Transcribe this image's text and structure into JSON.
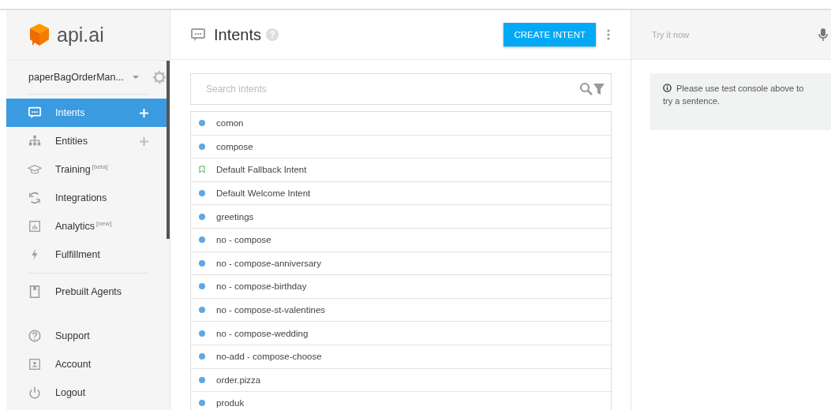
{
  "logo": {
    "text": "api.ai"
  },
  "agent": {
    "name": "paperBagOrderMan..."
  },
  "nav_groups": [
    {
      "items": [
        {
          "label": "Intents",
          "selected": true,
          "add": true
        },
        {
          "label": "Entities",
          "selected": false,
          "add": true
        },
        {
          "label": "Training",
          "selected": false,
          "add": false,
          "tag": "[beta]"
        },
        {
          "label": "Integrations",
          "selected": false,
          "add": false
        },
        {
          "label": "Analytics",
          "selected": false,
          "add": false,
          "tag": "[new]"
        },
        {
          "label": "Fulfillment",
          "selected": false,
          "add": false
        }
      ]
    },
    {
      "items": [
        {
          "label": "Prebuilt Agents",
          "selected": false,
          "add": false
        }
      ]
    },
    {
      "items": [
        {
          "label": "Support",
          "selected": false,
          "add": false
        },
        {
          "label": "Account",
          "selected": false,
          "add": false
        },
        {
          "label": "Logout",
          "selected": false,
          "add": false
        }
      ]
    }
  ],
  "header": {
    "title": "Intents",
    "button": "CREATE INTENT"
  },
  "search": {
    "placeholder": "Search intents"
  },
  "intents": [
    {
      "name": "comon",
      "kind": "dot"
    },
    {
      "name": "compose",
      "kind": "dot"
    },
    {
      "name": "Default Fallback Intent",
      "kind": "fallback"
    },
    {
      "name": "Default Welcome Intent",
      "kind": "dot"
    },
    {
      "name": "greetings",
      "kind": "dot"
    },
    {
      "name": "no - compose",
      "kind": "dot"
    },
    {
      "name": "no - compose-anniversary",
      "kind": "dot"
    },
    {
      "name": "no - compose-birthday",
      "kind": "dot"
    },
    {
      "name": "no - compose-st-valentines",
      "kind": "dot"
    },
    {
      "name": "no - compose-wedding",
      "kind": "dot"
    },
    {
      "name": "no-add - compose-choose",
      "kind": "dot"
    },
    {
      "name": "order.pizza",
      "kind": "dot"
    },
    {
      "name": "produk",
      "kind": "dot"
    }
  ],
  "console": {
    "placeholder": "Try it now",
    "message": "Please use test console above to try a sentence."
  }
}
